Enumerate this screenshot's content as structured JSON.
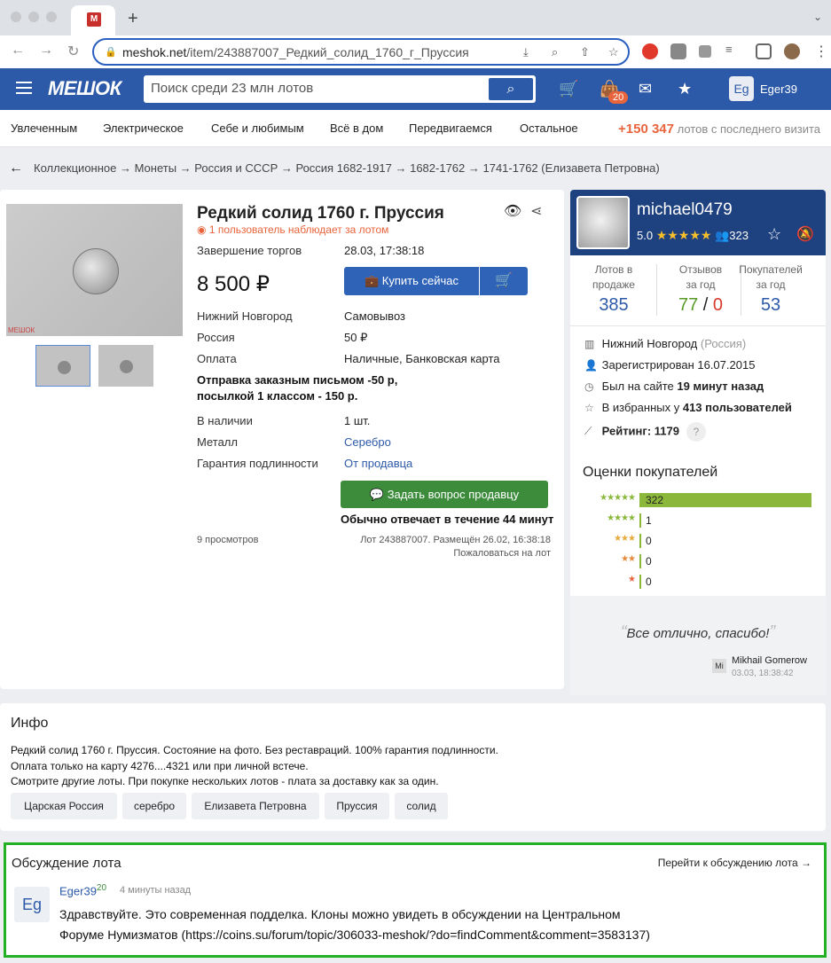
{
  "browser": {
    "url_host": "meshok.net",
    "url_path": "/item/243887007_Редкий_солид_1760_г_Пруссия"
  },
  "header": {
    "logo": "МЕШОК",
    "search_placeholder": "Поиск среди 23 млн лотов",
    "cart_badge": "20",
    "user_initials": "Eg",
    "user_name": "Eger39"
  },
  "categories": [
    "Увлеченным",
    "Электрическое",
    "Себе и любимым",
    "Всё в дом",
    "Передвигаемся",
    "Остальное"
  ],
  "new_lots": {
    "count": "+150 347",
    "text": "лотов с последнего визита"
  },
  "breadcrumbs": "Коллекционное → Монеты → Россия и СССР → Россия 1682-1917 → 1682-1762 → 1741-1762 (Елизавета Петровна)",
  "lot": {
    "photo_watermark": "МЕШОК",
    "title": "Редкий солид 1760 г. Пруссия",
    "watchers": "1 пользователь наблюдает за лотом",
    "end_label": "Завершение торгов",
    "end_value": "28.03, 17:38:18",
    "price": "8 500 ₽",
    "buy_label": "Купить сейчас",
    "city": "Нижний Новгород",
    "pickup": "Самовывоз",
    "country": "Россия",
    "country_ship": "50 ₽",
    "payment_label": "Оплата",
    "payment_value": "Наличные, Банковская карта",
    "shipping_note_1": "Отправка заказным письмом -50 р,",
    "shipping_note_2": "посылкой 1 классом - 150 р.",
    "stock_label": "В наличии",
    "stock_value": "1 шт.",
    "metal_label": "Металл",
    "metal_value": "Серебро",
    "guarantee_label": "Гарантия подлинности",
    "guarantee_value": "От продавца",
    "ask_label": "Задать вопрос продавцу",
    "reply_time": "Обычно отвечает в течение 44 минут",
    "views": "9 просмотров",
    "lot_no": "Лот 243887007. Размещён 26.02, 16:38:18",
    "complain": "Пожаловаться на лот"
  },
  "seller": {
    "name": "michael0479",
    "rating": "5.0",
    "followers": "323",
    "stats": [
      {
        "title_1": "Лотов в",
        "title_2": "продаже",
        "value": "385"
      },
      {
        "title_1": "Отзывов",
        "title_2": "за год",
        "value_pos": "77",
        "value_sep": " / ",
        "value_neg": "0"
      },
      {
        "title_1": "Покупателей",
        "title_2": "за год",
        "value": "53"
      }
    ],
    "city": "Нижний Новгород",
    "country": "(Россия)",
    "registered": "Зарегистрирован 16.07.2015",
    "last_seen_prefix": "Был на сайте",
    "last_seen": "19 минут назад",
    "favorites_prefix": "В избранных у",
    "favorites": "413 пользователей",
    "rating_label": "Рейтинг:",
    "rating_value": "1179",
    "rating_help": "?"
  },
  "reviews": {
    "title": "Оценки покупателей",
    "rows": [
      {
        "stars": "★★★★★",
        "count": 322,
        "label": "322"
      },
      {
        "stars": "★★★★",
        "count": 1,
        "label": "1"
      },
      {
        "stars": "★★★",
        "count": 0,
        "label": "0"
      },
      {
        "stars": "★★",
        "count": 0,
        "label": "0"
      },
      {
        "stars": "★",
        "count": 0,
        "label": "0"
      }
    ],
    "quote": "Все отлично, спасибо!",
    "quote_author_initials": "Mi",
    "quote_author": "Mikhail Gomerow",
    "quote_date": "03.03, 18:38:42"
  },
  "info": {
    "title": "Инфо",
    "line_1": "Редкий солид 1760 г. Пруссия. Состояние на фото. Без реставраций. 100% гарантия подлинности.",
    "line_2": "Оплата только на карту 4276....4321 или при личной встече.",
    "line_3": "Смотрите другие лоты. При покупке нескольких лотов - плата за доставку как за один.",
    "tags": [
      "Царская Россия",
      "серебро",
      "Елизавета Петровна",
      "Пруссия",
      "солид"
    ]
  },
  "discussion": {
    "title": "Обсуждение лота",
    "link": "Перейти к обсуждению лота",
    "author_initials": "Eg",
    "author": "Eger39",
    "author_level": "20",
    "time": "4 минуты назад",
    "text_1": "Здравствуйте. Это современная подделка. Клоны можно увидеть в обсуждении на Центральном",
    "text_2": "Форуме Нумизматов (https://coins.su/forum/topic/306033-meshok/?do=findComment&comment=3583137)"
  },
  "colors": {
    "brand_blue": "#2d5aa8",
    "accent_orange": "#e8643c",
    "ask_green": "#3c8c3c",
    "review_green": "#8bb73a",
    "highlight_border": "#22b024"
  }
}
